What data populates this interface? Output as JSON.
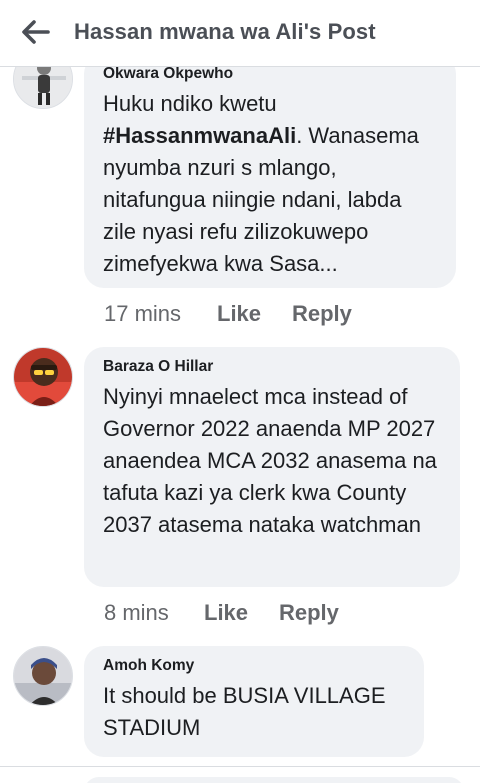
{
  "header": {
    "title": "Hassan mwana wa Ali's Post"
  },
  "comments": [
    {
      "author": "Okwara Okpewho",
      "text_before": "Huku ndiko kwetu ",
      "hashtag": "#HassanmwanaAli",
      "text_after": ". Wanasema nyumba nzuri s mlango, nitafungua niingie ndani, labda zile nyasi refu zilizokuwepo zimefyekwa kwa Sasa...",
      "time": "17 mins",
      "like": "Like",
      "reply": "Reply"
    },
    {
      "author": "Baraza O Hillar",
      "text": "Nyinyi mnaelect mca instead of Governor 2022 anaenda MP 2027 anaendea MCA 2032 anasema na tafuta kazi ya clerk kwa County 2037 atasema nataka watchman",
      "time": "8 mins",
      "like": "Like",
      "reply": "Reply"
    },
    {
      "author": "Amoh Komy",
      "text": "It should be BUSIA VILLAGE STADIUM"
    }
  ],
  "colors": {
    "bubble": "#f0f2f5",
    "meta": "#65676b",
    "title": "#4b4f56"
  },
  "icons": {
    "back": "arrow-left-icon"
  }
}
